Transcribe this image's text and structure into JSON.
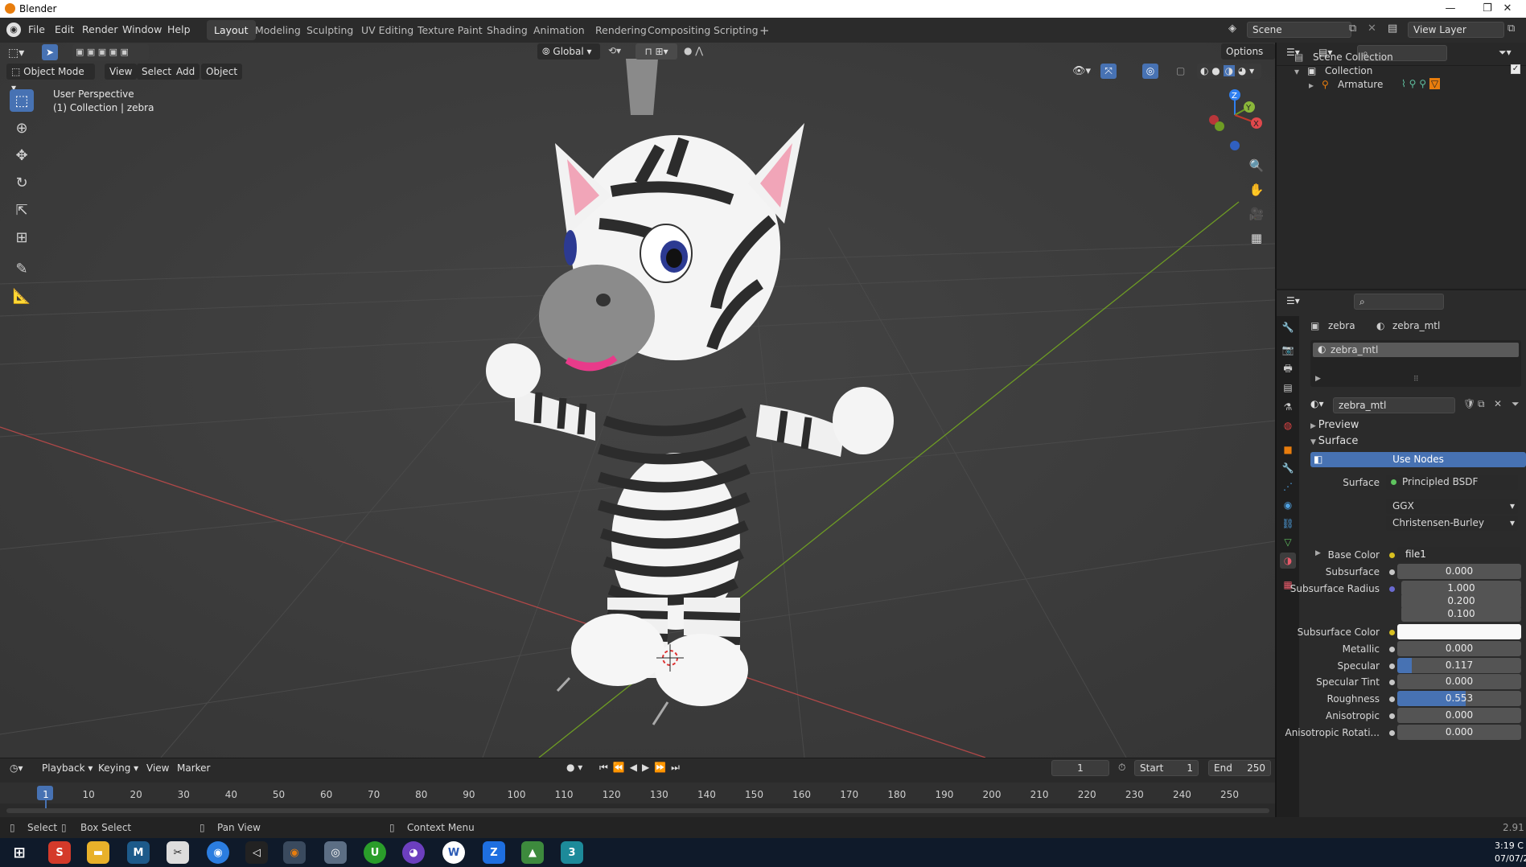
{
  "window": {
    "title": "Blender",
    "controls": [
      "—",
      "❐",
      "✕"
    ]
  },
  "menus": [
    "File",
    "Edit",
    "Render",
    "Window",
    "Help"
  ],
  "workspaces": [
    "Layout",
    "Modeling",
    "Sculpting",
    "UV Editing",
    "Texture Paint",
    "Shading",
    "Animation",
    "Rendering",
    "Compositing",
    "Scripting"
  ],
  "active_workspace": "Layout",
  "scene": {
    "name": "Scene",
    "view_layer": "View Layer"
  },
  "viewport": {
    "mode": "Object Mode",
    "menus": [
      "View",
      "Select",
      "Add",
      "Object"
    ],
    "orientation": "Global",
    "options_label": "Options",
    "overlay_title": "User Perspective",
    "overlay_subtitle": "(1) Collection | zebra",
    "gizmo_axes": [
      "Z",
      "Y",
      "X"
    ]
  },
  "outliner": {
    "scene_collection": "Scene Collection",
    "collection": "Collection",
    "armature": "Armature"
  },
  "properties": {
    "object_name": "zebra",
    "material_name": "zebra_mtl",
    "slot_name": "zebra_mtl",
    "material_field": "zebra_mtl",
    "sections": {
      "preview": "Preview",
      "surface": "Surface"
    },
    "use_nodes_label": "Use Nodes",
    "surface_label": "Surface",
    "surface_shader": "Principled BSDF",
    "distribution": "GGX",
    "subsurface_method": "Christensen-Burley",
    "fields": [
      {
        "label": "Base Color",
        "value": "file1",
        "kind": "link"
      },
      {
        "label": "Subsurface",
        "value": "0.000",
        "kind": "num"
      },
      {
        "label": "Subsurface Radius",
        "value": "1.000",
        "kind": "num"
      },
      {
        "label": "",
        "value": "0.200",
        "kind": "num"
      },
      {
        "label": "",
        "value": "0.100",
        "kind": "num"
      },
      {
        "label": "Subsurface Color",
        "value": "",
        "kind": "color"
      },
      {
        "label": "Metallic",
        "value": "0.000",
        "kind": "num"
      },
      {
        "label": "Specular",
        "value": "0.117",
        "kind": "slider",
        "fraction": 0.117
      },
      {
        "label": "Specular Tint",
        "value": "0.000",
        "kind": "num"
      },
      {
        "label": "Roughness",
        "value": "0.553",
        "kind": "slider",
        "fraction": 0.553
      },
      {
        "label": "Anisotropic",
        "value": "0.000",
        "kind": "num"
      },
      {
        "label": "Anisotropic Rotati...",
        "value": "0.000",
        "kind": "num"
      }
    ]
  },
  "timeline": {
    "menus": [
      "Playback",
      "Keying",
      "View",
      "Marker"
    ],
    "current_frame": "1",
    "start_label": "Start",
    "start": "1",
    "end_label": "End",
    "end": "250",
    "ruler": [
      "1",
      "10",
      "20",
      "30",
      "40",
      "50",
      "60",
      "70",
      "80",
      "90",
      "100",
      "110",
      "120",
      "130",
      "140",
      "150",
      "160",
      "170",
      "180",
      "190",
      "200",
      "210",
      "220",
      "230",
      "240",
      "250"
    ]
  },
  "statusbar": {
    "select": "Select",
    "box_select": "Box Select",
    "pan_view": "Pan View",
    "context_menu": "Context Menu",
    "version": "2.91"
  },
  "taskbar": {
    "time": "3:19 C",
    "date": "07/07/2",
    "apps": [
      "start",
      "snagit",
      "files",
      "m-app",
      "puzzle",
      "chrome",
      "unity",
      "blender",
      "fusion",
      "upwork",
      "github",
      "word-app",
      "zalo",
      "android",
      "three"
    ]
  },
  "colors": {
    "accent": "#4772b3",
    "x_axis": "#c0392b",
    "y_axis": "#6a9a1a",
    "z_axis": "#2f7ff0",
    "orange": "#e87d0d"
  }
}
